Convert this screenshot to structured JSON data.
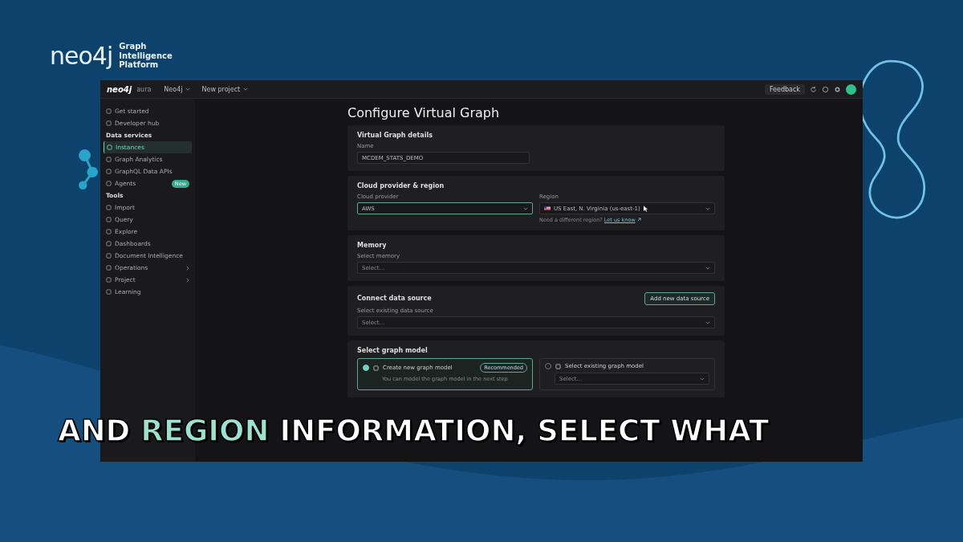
{
  "branding": {
    "wordmark": "neo4j",
    "tagline": "Graph Intelligence Platform"
  },
  "window": {
    "logo": "neo4j",
    "product": "aura",
    "breadcrumbs": [
      {
        "label": "Neo4j"
      },
      {
        "label": "New project"
      }
    ],
    "feedback": "Feedback"
  },
  "sidebar": {
    "items": [
      {
        "kind": "item",
        "label": "Get started",
        "selected": false,
        "submenu": false
      },
      {
        "kind": "item",
        "label": "Developer hub",
        "selected": false,
        "submenu": false
      },
      {
        "kind": "header",
        "label": "Data services"
      },
      {
        "kind": "item",
        "label": "Instances",
        "selected": true,
        "submenu": false
      },
      {
        "kind": "item",
        "label": "Graph Analytics",
        "selected": false,
        "submenu": false
      },
      {
        "kind": "item",
        "label": "GraphQL Data APIs",
        "selected": false,
        "submenu": false
      },
      {
        "kind": "item",
        "label": "Agents",
        "selected": false,
        "submenu": false,
        "badge": "New"
      },
      {
        "kind": "header",
        "label": "Tools"
      },
      {
        "kind": "item",
        "label": "Import",
        "selected": false,
        "submenu": false
      },
      {
        "kind": "item",
        "label": "Query",
        "selected": false,
        "submenu": false
      },
      {
        "kind": "item",
        "label": "Explore",
        "selected": false,
        "submenu": false
      },
      {
        "kind": "item",
        "label": "Dashboards",
        "selected": false,
        "submenu": false
      },
      {
        "kind": "item",
        "label": "Document Intelligence",
        "selected": false,
        "submenu": false
      },
      {
        "kind": "item",
        "label": "Operations",
        "selected": false,
        "submenu": true
      },
      {
        "kind": "item",
        "label": "Project",
        "selected": false,
        "submenu": true
      },
      {
        "kind": "item",
        "label": "Learning",
        "selected": false,
        "submenu": false
      }
    ]
  },
  "form": {
    "title": "Configure Virtual Graph",
    "details": {
      "heading": "Virtual Graph details",
      "name_label": "Name",
      "name_value": "MCDEM_STATS_DEMO"
    },
    "cloud": {
      "heading": "Cloud provider & region",
      "provider_label": "Cloud provider",
      "provider_value": "AWS",
      "provider_focused": true,
      "region_label": "Region",
      "region_value": "US East, N. Virginia (us-east-1)",
      "region_note": "Need a different region?",
      "region_link": "Let us know"
    },
    "memory": {
      "heading": "Memory",
      "label": "Select memory",
      "placeholder": "Select..."
    },
    "data_source": {
      "heading": "Connect data source",
      "button": "Add new data source",
      "label": "Select existing data source",
      "placeholder": "Select..."
    },
    "graph_model": {
      "heading": "Select graph model",
      "options": [
        {
          "label": "Create new graph model",
          "badge": "Recommended",
          "description": "You can model the graph model in the next step",
          "selected": true
        },
        {
          "label": "Select existing graph model",
          "placeholder": "Select...",
          "selected": false
        }
      ]
    }
  },
  "caption": {
    "segments": [
      {
        "text": "AND ",
        "highlight": false
      },
      {
        "text": "REGION",
        "highlight": true
      },
      {
        "text": " INFORMATION, SELECT WHAT",
        "highlight": false
      }
    ]
  }
}
